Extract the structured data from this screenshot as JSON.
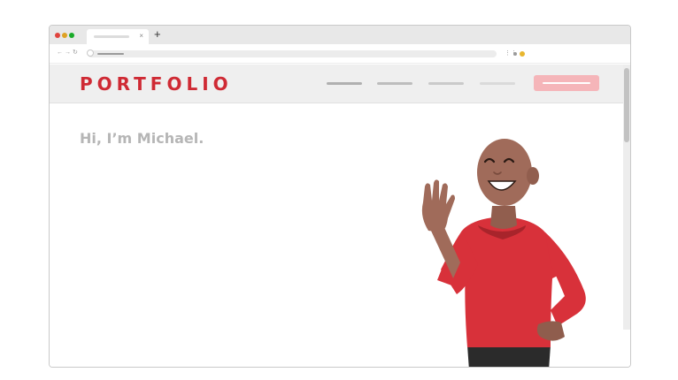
{
  "browser": {
    "tab": {
      "close_icon": "×"
    },
    "new_tab_icon": "+",
    "nav": {
      "back_icon": "←",
      "forward_icon": "→",
      "reload_icon": "↻"
    },
    "extensions_icon": "⋮⋮"
  },
  "site": {
    "logo": "PORTFOLIO",
    "greeting": "Hi, I’m Michael.",
    "colors": {
      "brand": "#cf2a34",
      "cta": "#f5b5b9",
      "shirt": "#d8313a",
      "skin": "#a06b5a"
    },
    "illustration": "waving-man-illustration"
  }
}
